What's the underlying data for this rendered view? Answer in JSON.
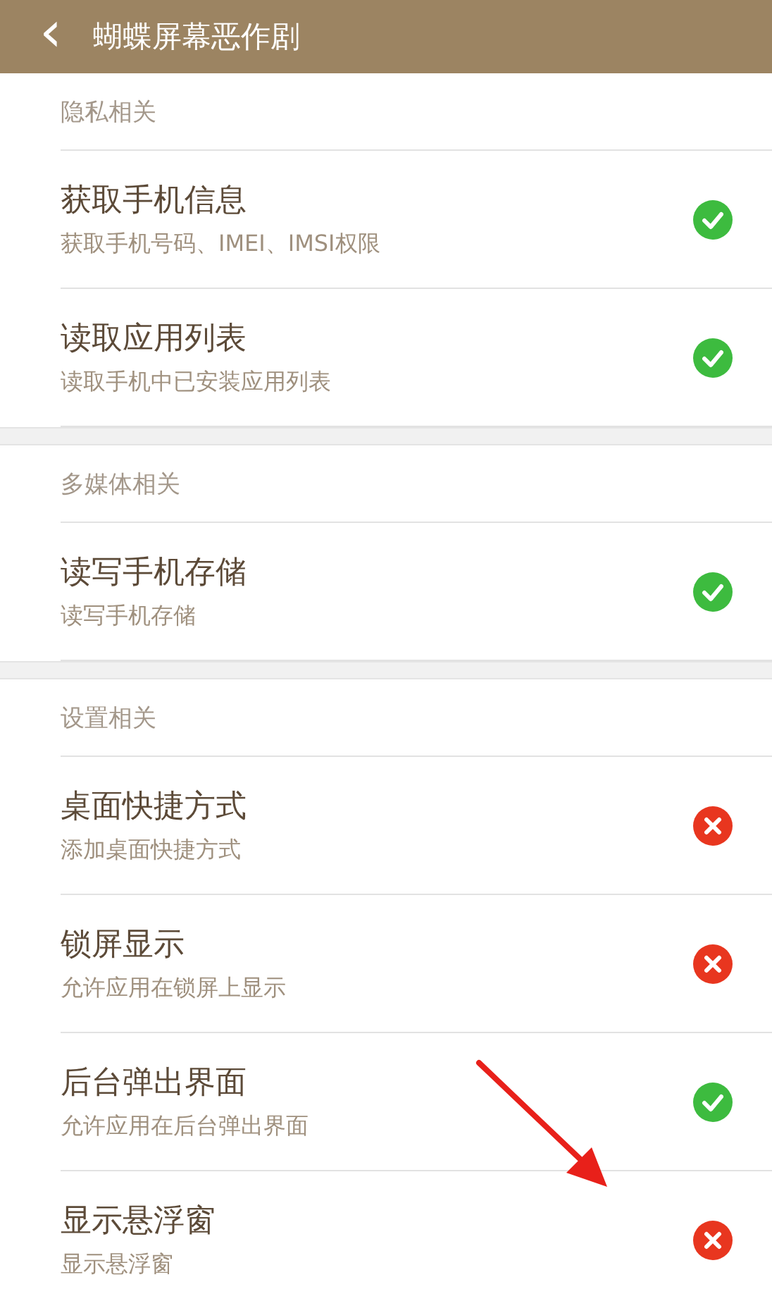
{
  "header": {
    "back": "‹",
    "title": "蝴蝶屏幕恶作剧"
  },
  "sections": [
    {
      "title": "隐私相关",
      "items": [
        {
          "title": "获取手机信息",
          "subtitle": "获取手机号码、IMEI、IMSI权限",
          "allowed": true
        },
        {
          "title": "读取应用列表",
          "subtitle": "读取手机中已安装应用列表",
          "allowed": true
        }
      ]
    },
    {
      "title": "多媒体相关",
      "items": [
        {
          "title": "读写手机存储",
          "subtitle": "读写手机存储",
          "allowed": true
        }
      ]
    },
    {
      "title": "设置相关",
      "items": [
        {
          "title": "桌面快捷方式",
          "subtitle": "添加桌面快捷方式",
          "allowed": false
        },
        {
          "title": "锁屏显示",
          "subtitle": "允许应用在锁屏上显示",
          "allowed": false
        },
        {
          "title": "后台弹出界面",
          "subtitle": "允许应用在后台弹出界面",
          "allowed": true
        },
        {
          "title": "显示悬浮窗",
          "subtitle": "显示悬浮窗",
          "allowed": false
        }
      ]
    }
  ]
}
